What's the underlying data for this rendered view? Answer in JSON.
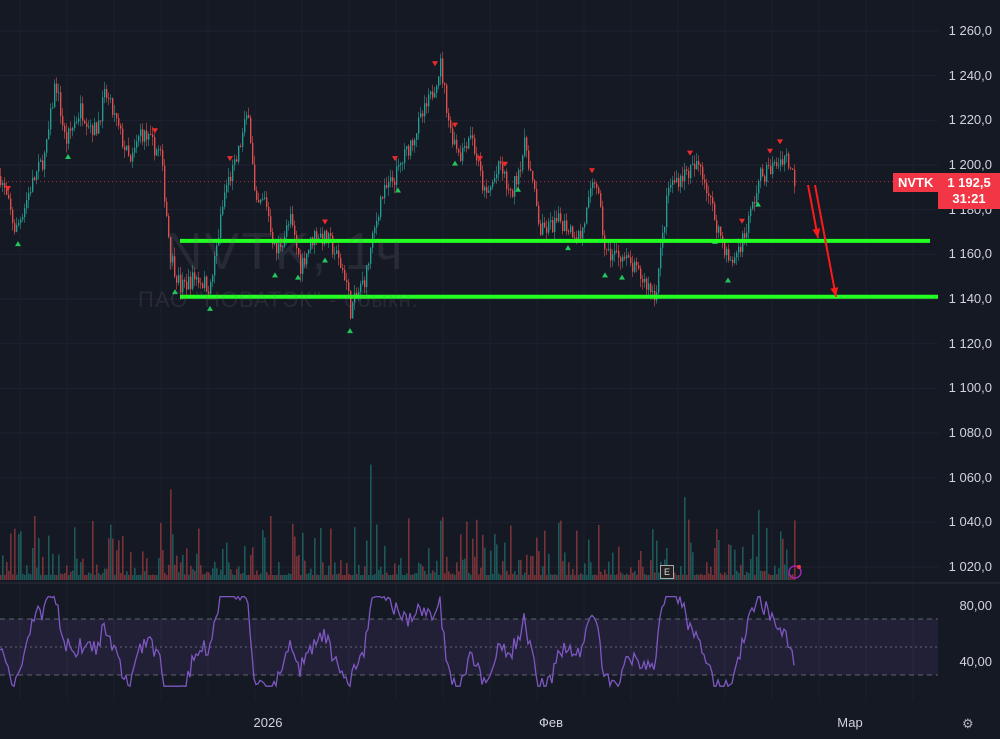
{
  "symbol": {
    "ticker": "NVTK",
    "interval_watermark": "NVTK, 1ч",
    "company_watermark": "ПАО \"НОВАТЭК\" - обыкн.",
    "last_price": "1 192,5",
    "countdown": "31:21"
  },
  "colors": {
    "up": "#26a69a",
    "down": "#ef5350",
    "support": "#22ff22",
    "arrow": "#ff1a1a",
    "rsi": "#7e57c2",
    "tag": "#f23645"
  },
  "price_axis": [
    "1 260,0",
    "1 240,0",
    "1 220,0",
    "1 200,0",
    "1 180,0",
    "1 160,0",
    "1 140,0",
    "1 120,0",
    "1 100,0",
    "1 080,0",
    "1 060,0",
    "1 040,0",
    "1 020,0"
  ],
  "rsi_axis": [
    "80,00",
    "40,00"
  ],
  "time_axis": [
    "2026",
    "Фев",
    "Мар"
  ],
  "icons": {
    "earnings": "E",
    "settings": "gear-icon",
    "alert": "lightning-icon"
  },
  "chart_data": {
    "type": "candlestick",
    "title": "NVTK, 1ч",
    "ylim": [
      1020,
      1260
    ],
    "support_levels": [
      1166,
      1141
    ],
    "rsi_levels": [
      70,
      50,
      30
    ],
    "price_path": [
      [
        0,
        1195
      ],
      [
        15,
        1170
      ],
      [
        30,
        1190
      ],
      [
        45,
        1205
      ],
      [
        55,
        1238
      ],
      [
        65,
        1210
      ],
      [
        80,
        1225
      ],
      [
        95,
        1215
      ],
      [
        105,
        1232
      ],
      [
        115,
        1220
      ],
      [
        130,
        1200
      ],
      [
        140,
        1215
      ],
      [
        160,
        1205
      ],
      [
        170,
        1160
      ],
      [
        180,
        1145
      ],
      [
        195,
        1150
      ],
      [
        210,
        1145
      ],
      [
        225,
        1190
      ],
      [
        235,
        1200
      ],
      [
        248,
        1225
      ],
      [
        255,
        1180
      ],
      [
        265,
        1185
      ],
      [
        275,
        1160
      ],
      [
        290,
        1175
      ],
      [
        300,
        1155
      ],
      [
        315,
        1170
      ],
      [
        330,
        1165
      ],
      [
        345,
        1150
      ],
      [
        350,
        1135
      ],
      [
        365,
        1150
      ],
      [
        380,
        1185
      ],
      [
        395,
        1195
      ],
      [
        410,
        1210
      ],
      [
        430,
        1230
      ],
      [
        440,
        1245
      ],
      [
        450,
        1215
      ],
      [
        460,
        1205
      ],
      [
        470,
        1215
      ],
      [
        485,
        1185
      ],
      [
        500,
        1200
      ],
      [
        510,
        1185
      ],
      [
        525,
        1210
      ],
      [
        540,
        1170
      ],
      [
        560,
        1175
      ],
      [
        580,
        1168
      ],
      [
        595,
        1195
      ],
      [
        605,
        1160
      ],
      [
        620,
        1160
      ],
      [
        640,
        1150
      ],
      [
        655,
        1142
      ],
      [
        668,
        1190
      ],
      [
        680,
        1195
      ],
      [
        700,
        1200
      ],
      [
        715,
        1175
      ],
      [
        730,
        1155
      ],
      [
        745,
        1170
      ],
      [
        760,
        1195
      ],
      [
        775,
        1200
      ],
      [
        785,
        1205
      ],
      [
        795,
        1192
      ]
    ],
    "buy_signals": [
      18,
      68,
      175,
      210,
      275,
      298,
      325,
      350,
      398,
      455,
      518,
      568,
      605,
      622,
      715,
      728,
      758
    ],
    "sell_signals": [
      8,
      155,
      230,
      325,
      395,
      435,
      455,
      480,
      505,
      592,
      690,
      742,
      770,
      780
    ]
  }
}
